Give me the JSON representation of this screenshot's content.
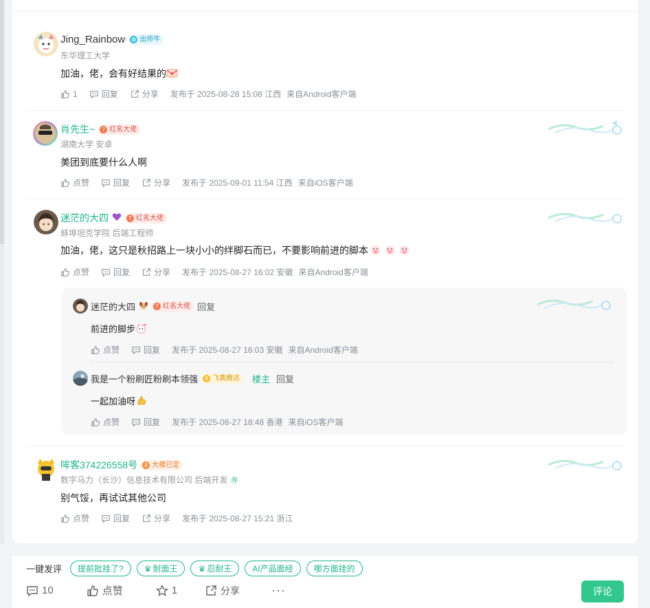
{
  "comments": [
    {
      "username": "Jing_Rainbow",
      "badge": "出师牛",
      "sub": "东华理工大学",
      "text": "加油，佬，会有好结果的",
      "like_label": "1",
      "reply_label": "回复",
      "share_label": "分享",
      "time": "发布于 2025-08-28 15:08 江西",
      "source": "来自Android客户端"
    },
    {
      "username": "肖先生~",
      "badge": "红名大佬",
      "sub": "湖南大学 安卓",
      "text": "美团到底要什么人啊",
      "like_label": "点赞",
      "reply_label": "回复",
      "share_label": "分享",
      "time": "发布于 2025-09-01 11:54 江西",
      "source": "来自iOS客户端"
    },
    {
      "username": "迷茫的大四",
      "badge": "红名大佬",
      "sub": "蚌埠坦克学院 后端工程师",
      "text": "加油，佬，这只是秋招路上一块小小的绊脚石而已，不要影响前进的脚本",
      "like_label": "点赞",
      "reply_label": "回复",
      "share_label": "分享",
      "time": "发布于 2025-08-27 16:02 安徽",
      "source": "来自Android客户端"
    },
    {
      "username": "哞客374226558号",
      "badge": "大楼已定",
      "sub": "数字马力（长沙）信息技术有限公司 后端开发",
      "text": "别气馁，再试试其他公司",
      "like_label": "点赞",
      "reply_label": "回复",
      "share_label": "分享",
      "time": "发布于 2025-08-27 15:21 浙江",
      "source": ""
    }
  ],
  "replies": [
    {
      "username": "迷茫的大四",
      "badge": "红名大佬",
      "reply_word": "回复",
      "text": "前进的脚步",
      "like_label": "点赞",
      "reply_label": "回复",
      "time": "发布于 2025-08-27 16:03 安徽",
      "source": "来自Android客户端"
    },
    {
      "username": "我是一个粉刷匠粉刷本领强",
      "badge": "飞黄腾达",
      "host_tag": "楼主",
      "reply_word": "回复",
      "text": "一起加油呀",
      "like_label": "点赞",
      "reply_label": "回复",
      "time": "发布于 2025-08-27 18:48 香港",
      "source": "来自iOS客户端"
    }
  ],
  "bottom": {
    "quick_label": "一键发评",
    "chips": [
      "提前批挂了?",
      "耐面王",
      "忍耐王",
      "AI产品面经",
      "哪方面挂的"
    ],
    "comment_count": "10",
    "like_label": "点赞",
    "star_count": "1",
    "share_label": "分享",
    "more_label": "···",
    "send_label": "评论"
  },
  "colors": {
    "accent": "#1fb58a",
    "send_button": "#32c88d"
  }
}
